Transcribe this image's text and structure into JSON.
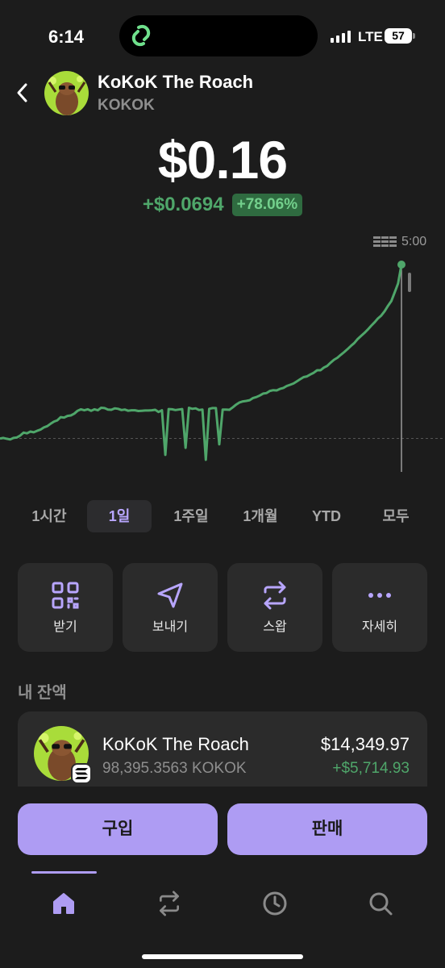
{
  "status_bar": {
    "time": "6:14",
    "network": "LTE",
    "battery": "57"
  },
  "token": {
    "name": "KoKoK The Roach",
    "symbol": "KOKOK"
  },
  "price": {
    "value": "$0.16",
    "change_amount": "+$0.0694",
    "change_percent": "+78.06%"
  },
  "chart": {
    "time_label": "5:00",
    "line_color": "#4fa66a"
  },
  "chart_data": {
    "type": "line",
    "title": "",
    "x": [
      0,
      1,
      2,
      3,
      4,
      5,
      6,
      7,
      8,
      9,
      10,
      11,
      12,
      13,
      14,
      15,
      16,
      17,
      18,
      19,
      20,
      21,
      22,
      23,
      24,
      25,
      26,
      27,
      28,
      29,
      30,
      31,
      32,
      33,
      34,
      35,
      36,
      37,
      38,
      39,
      40,
      41,
      42,
      43,
      44,
      45,
      46,
      47,
      48,
      49,
      50,
      51,
      52,
      53,
      54,
      55,
      56,
      57,
      58,
      59,
      60,
      61,
      62,
      63,
      64,
      65,
      66,
      67,
      68,
      69,
      70,
      71,
      72,
      73,
      74,
      75,
      76,
      77,
      78,
      79,
      80,
      81,
      82,
      83,
      84,
      85,
      86,
      87,
      88,
      89,
      90,
      91,
      92,
      93,
      94,
      95,
      96,
      97,
      98,
      99,
      100,
      101,
      102,
      103,
      104,
      105,
      106,
      107,
      108,
      109,
      110,
      111,
      112,
      113,
      114,
      115,
      116,
      117,
      118,
      119
    ],
    "values": [
      0.0891,
      0.0893,
      0.089,
      0.0887,
      0.0893,
      0.0895,
      0.0903,
      0.0915,
      0.0912,
      0.0919,
      0.0916,
      0.0922,
      0.0927,
      0.0936,
      0.0941,
      0.0951,
      0.096,
      0.0965,
      0.0978,
      0.0976,
      0.0983,
      0.0985,
      0.0992,
      0.1004,
      0.101,
      0.1006,
      0.101,
      0.1004,
      0.101,
      0.1006,
      0.1016,
      0.1015,
      0.1009,
      0.1008,
      0.1014,
      0.1012,
      0.1007,
      0.1009,
      0.1004,
      0.1006,
      0.1006,
      0.1003,
      0.1004,
      0.1005,
      0.1005,
      0.1006,
      0.1008,
      0.0999,
      0.1006,
      0.0824,
      0.1011,
      0.101,
      0.1007,
      0.1009,
      0.1011,
      0.0853,
      0.1016,
      0.1012,
      0.1014,
      0.1007,
      0.1009,
      0.0804,
      0.1012,
      0.1015,
      0.1015,
      0.0867,
      0.1009,
      0.1009,
      0.1008,
      0.1018,
      0.1029,
      0.1038,
      0.1042,
      0.1044,
      0.1047,
      0.1056,
      0.106,
      0.1066,
      0.1074,
      0.1076,
      0.1085,
      0.1088,
      0.1087,
      0.1093,
      0.1097,
      0.1105,
      0.111,
      0.1115,
      0.1124,
      0.1133,
      0.1141,
      0.1144,
      0.1152,
      0.1159,
      0.1169,
      0.1169,
      0.118,
      0.1187,
      0.12,
      0.1212,
      0.122,
      0.1232,
      0.1243,
      0.1255,
      0.1268,
      0.128,
      0.1296,
      0.1309,
      0.1321,
      0.1335,
      0.135,
      0.1364,
      0.138,
      0.1392,
      0.141,
      0.1432,
      0.1451,
      0.1487,
      0.1523,
      0.16
    ],
    "reference_line": 0.0891,
    "xlabel": "",
    "ylabel": "",
    "grid": false
  },
  "range_tabs": [
    {
      "label": "1시간",
      "active": false
    },
    {
      "label": "1일",
      "active": true
    },
    {
      "label": "1주일",
      "active": false
    },
    {
      "label": "1개월",
      "active": false
    },
    {
      "label": "YTD",
      "active": false
    },
    {
      "label": "모두",
      "active": false
    }
  ],
  "actions": [
    {
      "label": "받기",
      "icon": "qr-code-icon"
    },
    {
      "label": "보내기",
      "icon": "send-icon"
    },
    {
      "label": "스왑",
      "icon": "swap-icon"
    },
    {
      "label": "자세히",
      "icon": "more-icon"
    }
  ],
  "balance_section": {
    "title": "내 잔액",
    "token_name": "KoKoK The Roach",
    "token_amount": "98,395.3563 KOKOK",
    "usd_value": "$14,349.97",
    "usd_change": "+$5,714.93"
  },
  "buttons": {
    "buy": "구입",
    "sell": "판매"
  },
  "nav": [
    {
      "icon": "home-icon",
      "active": true
    },
    {
      "icon": "swap-icon",
      "active": false
    },
    {
      "icon": "history-icon",
      "active": false
    },
    {
      "icon": "search-icon",
      "active": false
    }
  ],
  "colors": {
    "accent": "#ae9cf3",
    "positive": "#4fa66a",
    "background": "#1c1c1c"
  }
}
